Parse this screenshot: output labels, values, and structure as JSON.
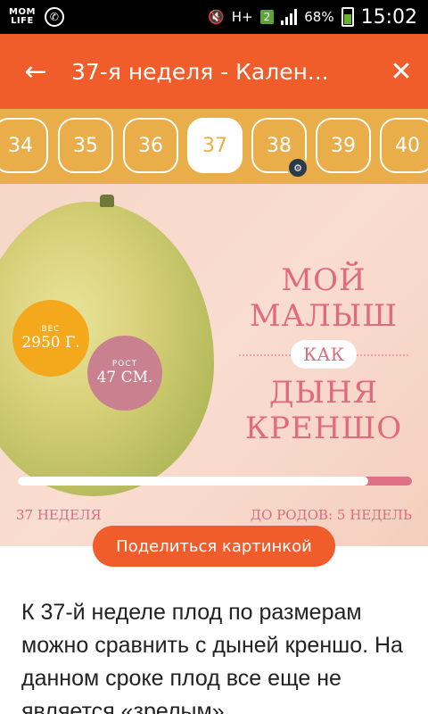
{
  "status_bar": {
    "app_logo_top": "MOM",
    "app_logo_bottom": "LIFE",
    "network": "H+",
    "sim": "2",
    "battery": "68%",
    "time": "15:02"
  },
  "appbar": {
    "title": "37-я неделя - Кален..."
  },
  "weeks": {
    "items": [
      "34",
      "35",
      "36",
      "37",
      "38",
      "39",
      "40"
    ],
    "selected": "37"
  },
  "hero": {
    "weight_label": "ВЕС",
    "weight_value": "2950 Г.",
    "height_label": "РОСТ",
    "height_value": "47 СМ.",
    "headline_top": "МОЙ МАЛЫШ",
    "headline_mid": "КАК",
    "headline_bottom": "ДЫНЯ КРЕНШО",
    "week_label": "37 НЕДЕЛЯ",
    "remaining_label": "ДО РОДОВ: 5 НЕДЕЛЬ",
    "progress": 0.89
  },
  "share_button": "Поделиться картинкой",
  "body_text": "К 37-й неделе плод по размерам можно сравнить с дыней креншо. На данном сроке плод все еще не является «зрелым»"
}
